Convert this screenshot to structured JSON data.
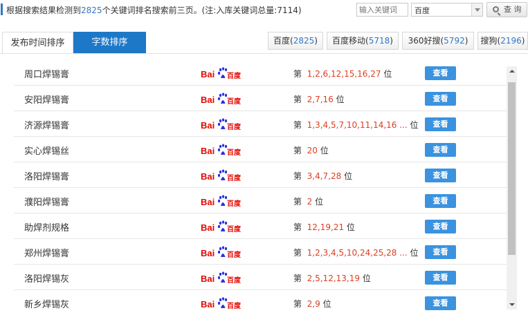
{
  "header": {
    "summary_prefix": "根据搜索结果检测到",
    "summary_count": "2825",
    "summary_suffix": "个关键词排名搜索前三页。(注:入库关键词总量:7114)",
    "keyword_placeholder": "输入关键词",
    "engine_selected": "百度",
    "query_label": "查 询"
  },
  "tabs": [
    {
      "label": "发布时间排序",
      "active": false
    },
    {
      "label": "字数排序",
      "active": true
    }
  ],
  "engines": [
    {
      "name": "百度(",
      "count": "2825",
      "close": ")"
    },
    {
      "name": "百度移动(",
      "count": "5718",
      "close": ")"
    },
    {
      "name": "360好搜(",
      "count": "5792",
      "close": ")"
    },
    {
      "name": "搜狗(",
      "count": "2196",
      "close": ")"
    }
  ],
  "logo": {
    "text": "Bai",
    "suffix": "百度",
    "icon": "baidu-paw-icon"
  },
  "rank_prefix": "第",
  "rank_suffix": "位",
  "view_label": "查看",
  "rows": [
    {
      "keyword": "周口焊锡膏",
      "positions": "1,2,6,12,15,16,27"
    },
    {
      "keyword": "安阳焊锡膏",
      "positions": "2,7,16"
    },
    {
      "keyword": "济源焊锡膏",
      "positions": "1,3,4,5,7,10,11,14,16 ..."
    },
    {
      "keyword": "实心焊锡丝",
      "positions": "20"
    },
    {
      "keyword": "洛阳焊锡膏",
      "positions": "3,4,7,28"
    },
    {
      "keyword": "濮阳焊锡膏",
      "positions": "2"
    },
    {
      "keyword": "助焊剂规格",
      "positions": "12,19,21"
    },
    {
      "keyword": "郑州焊锡膏",
      "positions": "1,2,3,4,5,10,24,25,28 ..."
    },
    {
      "keyword": "洛阳焊锡灰",
      "positions": "2,5,12,13,19"
    },
    {
      "keyword": "新乡焊锡灰",
      "positions": "2,9"
    }
  ],
  "colors": {
    "accent": "#1e78c8",
    "rank": "#e03c1f",
    "baidu_red": "#e10601",
    "baidu_blue": "#2932e1",
    "button": "#3b92df"
  }
}
